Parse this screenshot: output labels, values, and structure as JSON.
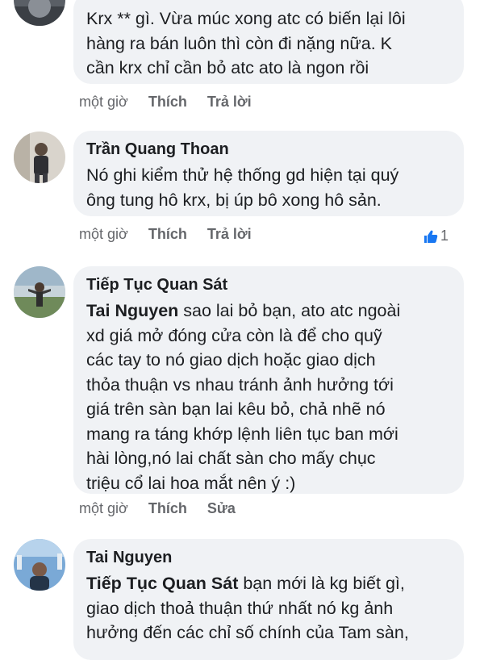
{
  "comments": [
    {
      "author": "",
      "lines": [
        "Krx ** gì. Vừa múc xong atc có biến lại lôi",
        "hàng ra bán luôn thì còn đi nặng nữa. K",
        "cần krx chỉ cần bỏ atc ato là ngon rồi"
      ],
      "time": "một giờ",
      "like_label": "Thích",
      "second_action": "Trả lời"
    },
    {
      "author": "Trần Quang Thoan",
      "lines": [
        "Nó ghi kiểm thử hệ thống gd hiện tại quý",
        "ông tung hô krx, bị úp bô xong hô sản."
      ],
      "time": "một giờ",
      "like_label": "Thích",
      "second_action": "Trả lời",
      "reaction_icon": "thumbs-up-icon",
      "reaction_count": "1"
    },
    {
      "author": "Tiếp Tục Quan Sát",
      "mention": "Tai Nguyen",
      "first_line_rest": " sao lai bỏ bạn, ato atc ngoài",
      "lines": [
        "xd giá mở đóng cửa còn là để cho quỹ",
        "các tay to nó giao dịch hoặc giao dịch",
        "thỏa thuận vs nhau tránh ảnh hưởng tới",
        "giá trên sàn  bạn lai kêu bỏ, chả nhẽ nó",
        "mang ra táng khớp lệnh liên tục ban mới",
        "hài lòng,nó lai chất sàn cho mấy chục",
        "triệu cổ lai hoa mắt nên ý :)"
      ],
      "time": "một giờ",
      "like_label": "Thích",
      "second_action": "Sửa"
    },
    {
      "author": "Tai Nguyen",
      "mention": "Tiếp Tục Quan Sát",
      "first_line_rest": " bạn mới là kg biết gì,",
      "lines": [
        "giao dịch thoả thuận thứ nhất nó kg ảnh",
        "hưởng đến các chỉ số chính của Tam sàn,"
      ]
    }
  ],
  "colors": {
    "bubble": "#f0f2f5",
    "meta_text": "#65676b",
    "like_blue": "#1877f2"
  }
}
